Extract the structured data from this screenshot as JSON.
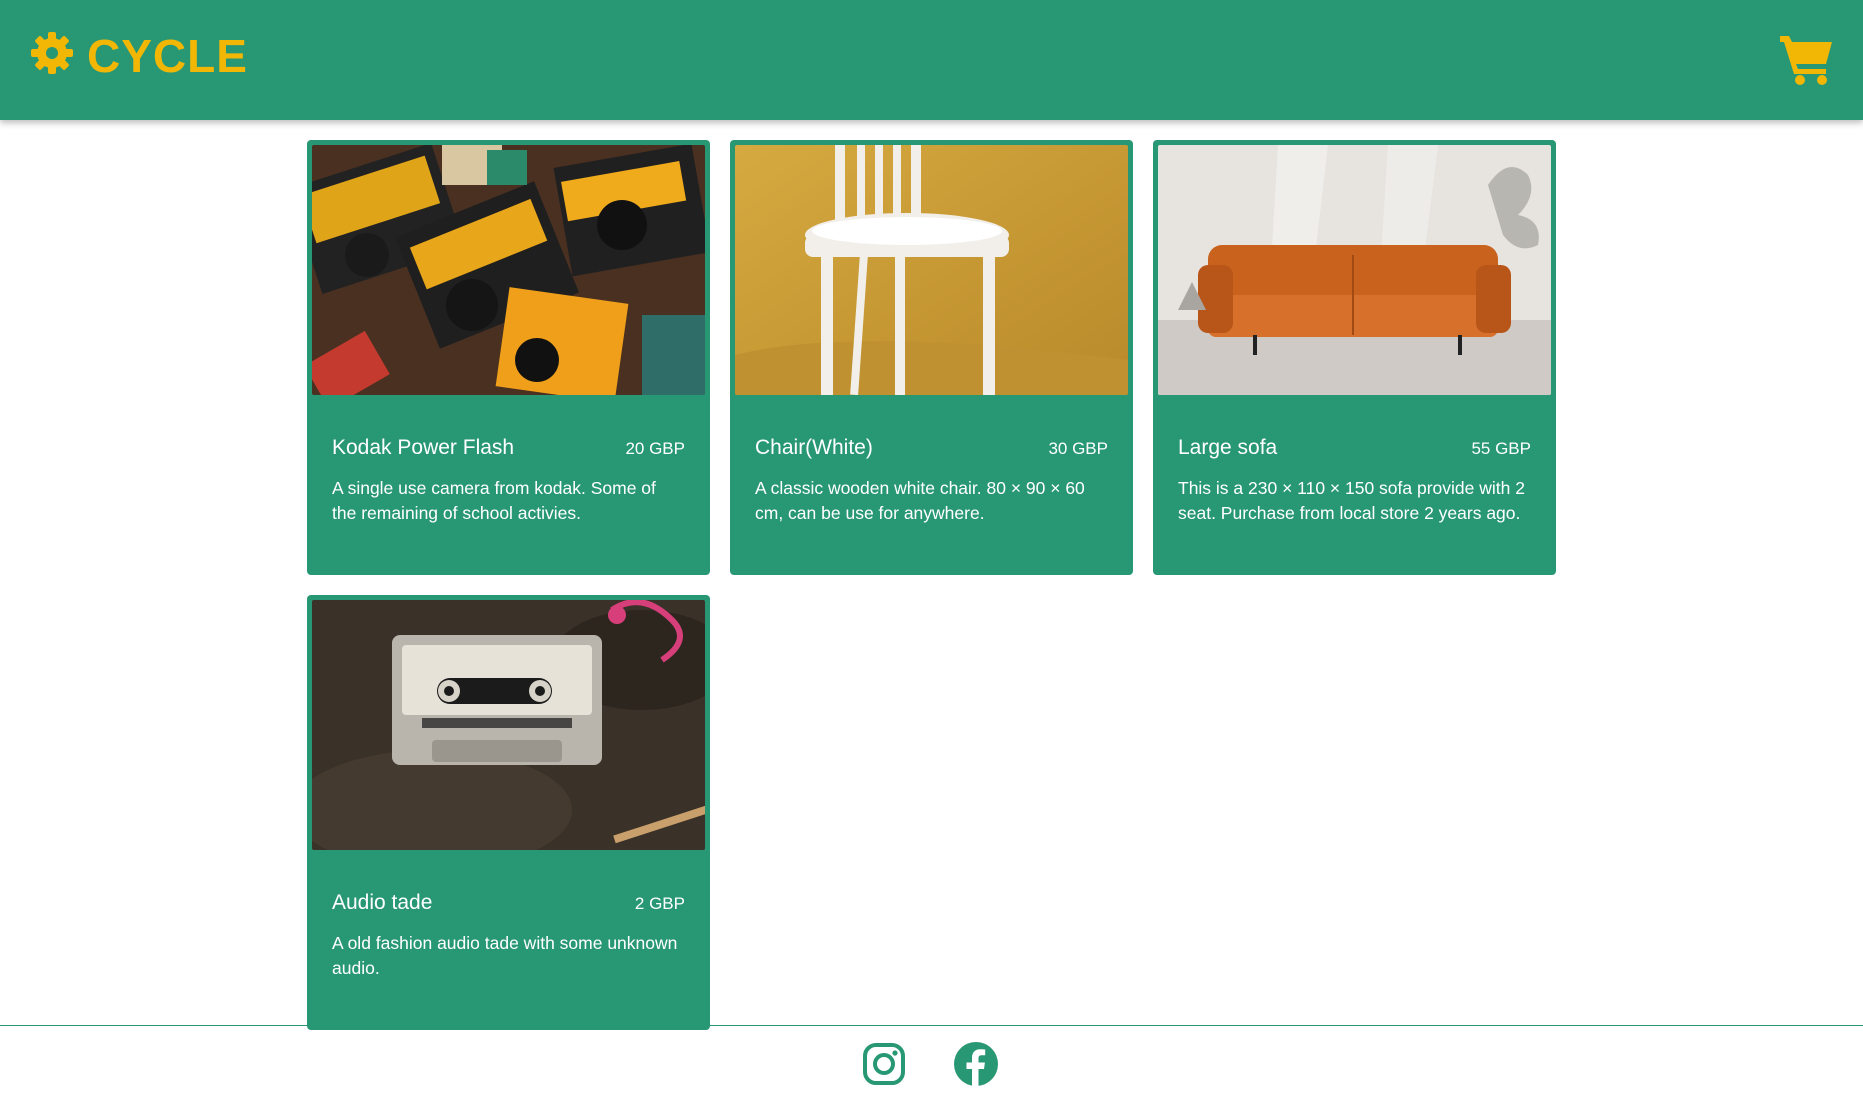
{
  "brand": {
    "name": "CYCLE",
    "logo_icon": "gear-icon",
    "color": "#f2b705"
  },
  "header": {
    "background": "#289774",
    "cart_icon": "shopping-cart-icon"
  },
  "products": [
    {
      "title": "Kodak Power Flash",
      "price": "20 GBP",
      "description": "A single use camera from kodak. Some of the remaining of school activies."
    },
    {
      "title": "Chair(White)",
      "price": "30 GBP",
      "description": "A classic wooden white chair. 80 × 90 × 60 cm, can be use for anywhere."
    },
    {
      "title": "Large sofa",
      "price": "55 GBP",
      "description": "This is a 230 × 110 × 150 sofa provide with 2 seat. Purchase from local store 2 years ago."
    },
    {
      "title": "Audio tade",
      "price": "2 GBP",
      "description": "A old fashion audio tade with some unknown audio."
    }
  ],
  "footer": {
    "social_icons": [
      "instagram-icon",
      "facebook-icon"
    ]
  }
}
